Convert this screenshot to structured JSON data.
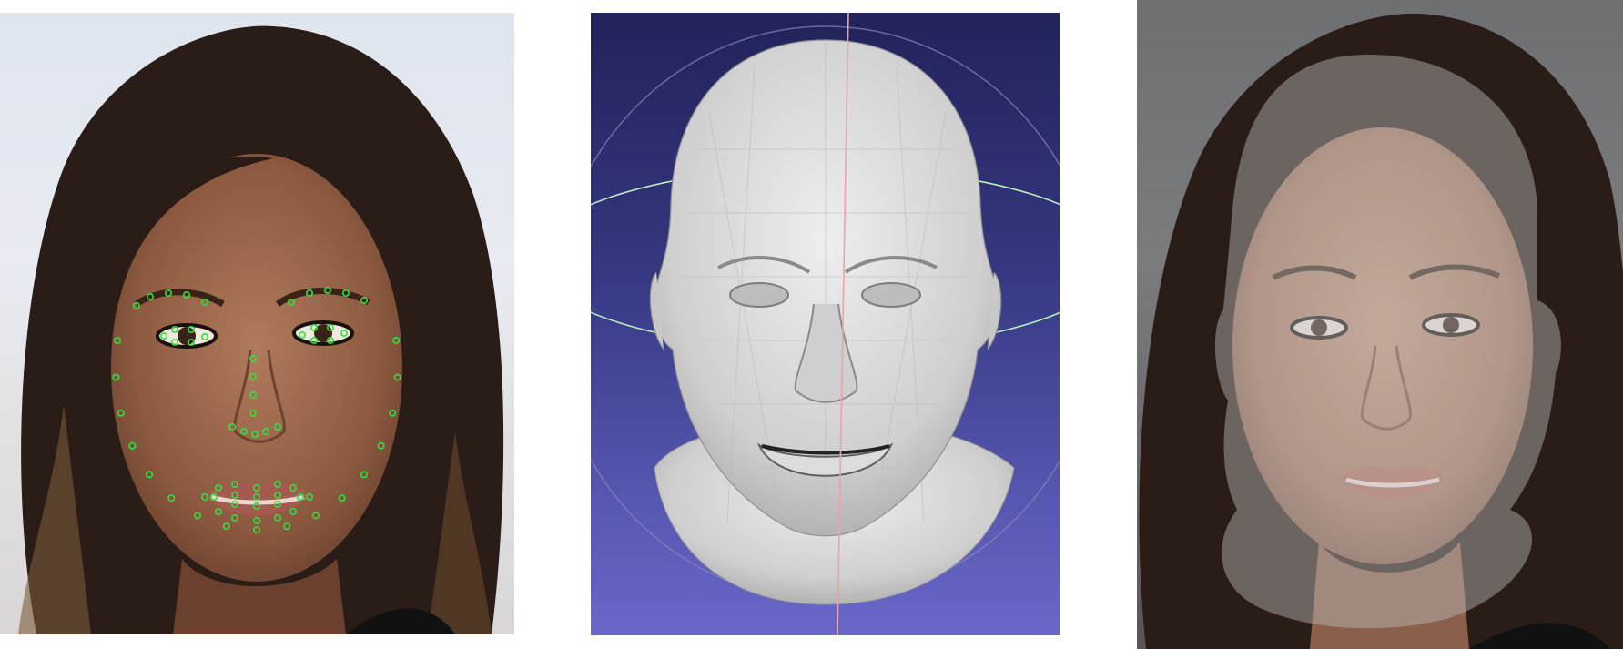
{
  "panels": [
    {
      "name": "landmark-photo",
      "description_icon": "face-landmarks-icon",
      "landmark_color": "#2ee23a"
    },
    {
      "name": "mesh-viewer",
      "description_icon": "3d-head-mesh-icon",
      "background_top": "#22235a",
      "background_bottom": "#6a67c9",
      "mesh_color": "#d9d9d9",
      "axis_red": "#e9a4a4",
      "axis_green": "#b8f0c0"
    },
    {
      "name": "overlay-photo",
      "description_icon": "face-overlay-icon",
      "overlay_color": "#bdbdbd"
    }
  ]
}
